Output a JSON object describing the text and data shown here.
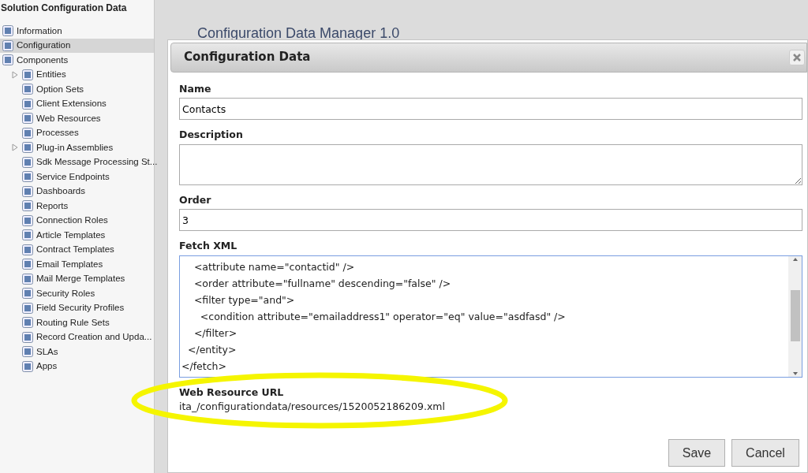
{
  "sidebar": {
    "title": "Solution Configuration Data",
    "items": [
      {
        "label": "Information",
        "selected": false
      },
      {
        "label": "Configuration",
        "selected": true
      },
      {
        "label": "Components",
        "selected": false,
        "children": [
          {
            "label": "Entities",
            "kind": "collapsed",
            "selected": false
          },
          {
            "label": "Option Sets",
            "kind": "leaf",
            "selected": false
          },
          {
            "label": "Client Extensions",
            "kind": "leaf",
            "selected": false
          },
          {
            "label": "Web Resources",
            "kind": "leaf",
            "selected": false
          },
          {
            "label": "Processes",
            "kind": "leaf",
            "selected": false
          },
          {
            "label": "Plug-in Assemblies",
            "kind": "collapsed",
            "selected": false
          },
          {
            "label": "Sdk Message Processing St...",
            "kind": "leaf",
            "selected": false
          },
          {
            "label": "Service Endpoints",
            "kind": "leaf",
            "selected": false
          },
          {
            "label": "Dashboards",
            "kind": "leaf",
            "selected": false
          },
          {
            "label": "Reports",
            "kind": "leaf",
            "selected": false
          },
          {
            "label": "Connection Roles",
            "kind": "leaf",
            "selected": false
          },
          {
            "label": "Article Templates",
            "kind": "leaf",
            "selected": false
          },
          {
            "label": "Contract Templates",
            "kind": "leaf",
            "selected": false
          },
          {
            "label": "Email Templates",
            "kind": "leaf",
            "selected": false
          },
          {
            "label": "Mail Merge Templates",
            "kind": "leaf",
            "selected": false
          },
          {
            "label": "Security Roles",
            "kind": "leaf",
            "selected": false
          },
          {
            "label": "Field Security Profiles",
            "kind": "leaf",
            "selected": false
          },
          {
            "label": "Routing Rule Sets",
            "kind": "leaf",
            "selected": false
          },
          {
            "label": "Record Creation and Upda...",
            "kind": "leaf",
            "selected": false
          },
          {
            "label": "SLAs",
            "kind": "leaf",
            "selected": false
          },
          {
            "label": "Apps",
            "kind": "leaf",
            "selected": false
          }
        ]
      }
    ]
  },
  "page_title": "Configuration Data Manager 1.0",
  "dialog": {
    "title": "Configuration Data",
    "fields": [
      {
        "kind": "input",
        "label": "Name",
        "value": "Contacts"
      },
      {
        "kind": "textarea",
        "label": "Description"
      },
      {
        "kind": "input",
        "label": "Order",
        "value": "3"
      },
      {
        "kind": "code",
        "label": "Fetch XML",
        "lines": [
          "    <attribute name=\"contactid\" />",
          "    <order attribute=\"fullname\" descending=\"false\" />",
          "    <filter type=\"and\">",
          "      <condition attribute=\"emailaddress1\" operator=\"eq\" value=\"asdfasd\" />",
          "    </filter>",
          "  </entity>",
          "</fetch>"
        ]
      },
      {
        "kind": "text",
        "label": "Web Resource URL",
        "value": "ita_/configurationdata/resources/1520052186209.xml"
      }
    ],
    "buttons": [
      "Save",
      "Cancel"
    ]
  }
}
